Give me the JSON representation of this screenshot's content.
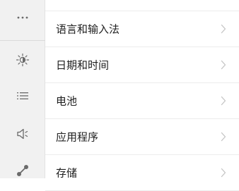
{
  "sidebar": {
    "items": [
      {
        "icon": "more-dots-icon"
      },
      {
        "icon": "brightness-icon"
      },
      {
        "icon": "list-icon"
      },
      {
        "icon": "speaker-icon"
      },
      {
        "icon": "connect-icon"
      }
    ]
  },
  "settings": {
    "items": [
      {
        "label": "语言和输入法"
      },
      {
        "label": "日期和时间"
      },
      {
        "label": "电池"
      },
      {
        "label": "应用程序"
      },
      {
        "label": "存储"
      }
    ]
  },
  "colors": {
    "sidebar_bg": "#f1f1f1",
    "icon": "#6a6a6a",
    "divider": "#ececec",
    "chevron": "#c4c4c4"
  }
}
